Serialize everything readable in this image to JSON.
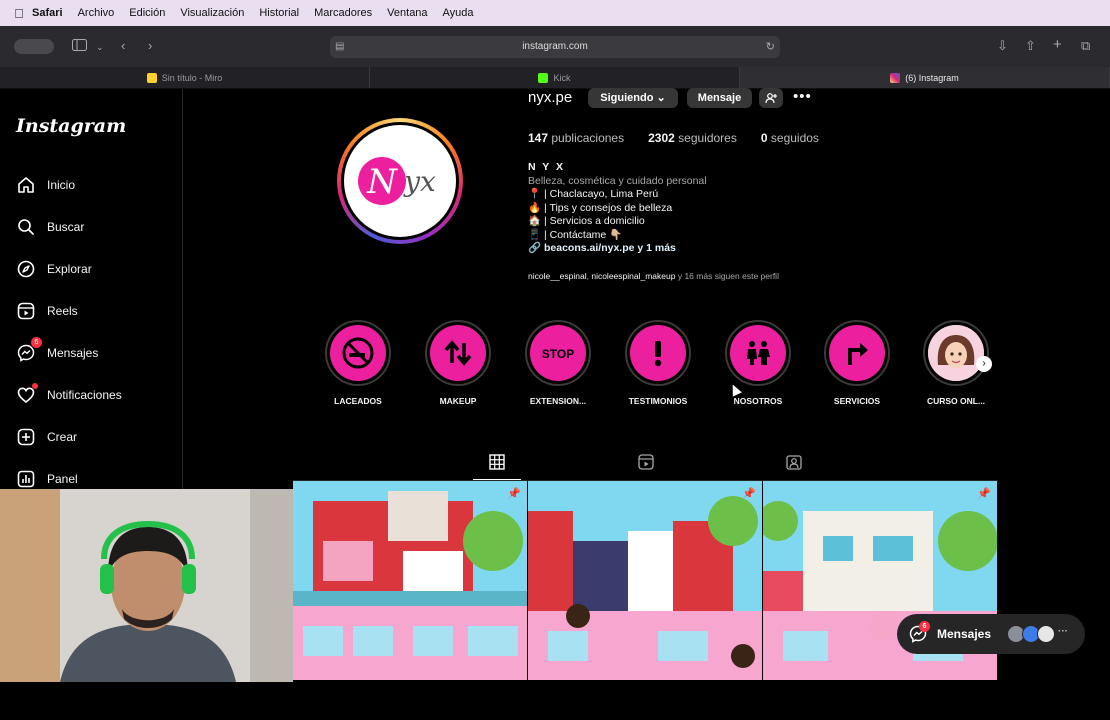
{
  "menubar": {
    "apple": "",
    "items": [
      "Safari",
      "Archivo",
      "Edición",
      "Visualización",
      "Historial",
      "Marcadores",
      "Ventana",
      "Ayuda"
    ]
  },
  "browser": {
    "url": "instagram.com",
    "tabs": [
      {
        "title": "Sin título - Miro",
        "favicon_color": "#ffd02f",
        "active": false
      },
      {
        "title": "Kick",
        "favicon_color": "#53fc18",
        "active": false
      },
      {
        "title": "(6) Instagram",
        "favicon_color": "#e1306c",
        "active": true
      }
    ]
  },
  "sidebar": {
    "logo": "Instagram",
    "items": [
      {
        "label": "Inicio",
        "icon": "home-icon"
      },
      {
        "label": "Buscar",
        "icon": "search-icon"
      },
      {
        "label": "Explorar",
        "icon": "compass-icon"
      },
      {
        "label": "Reels",
        "icon": "reels-icon"
      },
      {
        "label": "Mensajes",
        "icon": "messenger-icon",
        "badge": "6"
      },
      {
        "label": "Notificaciones",
        "icon": "heart-icon",
        "dot": true
      },
      {
        "label": "Crear",
        "icon": "plus-square-icon"
      },
      {
        "label": "Panel",
        "icon": "chart-icon"
      }
    ]
  },
  "profile": {
    "username": "nyx.pe",
    "following_btn": "Siguiendo",
    "message_btn": "Mensaje",
    "more": "•••",
    "avatar_text": "NYX",
    "stats": {
      "posts_count": "147",
      "posts_label": "publicaciones",
      "followers_count": "2302",
      "followers_label": "seguidores",
      "following_count": "0",
      "following_label": "seguidos"
    },
    "bio": {
      "name": "N Y X",
      "category": "Belleza, cosmética y cuidado personal",
      "lines": [
        "📍 | Chaclacayo, Lima Perú",
        "🔥 | Tips y consejos de belleza",
        "🏠 | Servicios a domicilio",
        "📱 | Contáctame 👇🏼"
      ],
      "link": "beacons.ai/nyx.pe y 1 más"
    },
    "followed_by": {
      "user1": "nicole__espinal",
      "user2": "nicoleespinal_makeup",
      "rest": "y 16 más siguen este perfil"
    }
  },
  "highlights": [
    {
      "label": "LACEADOS",
      "icon": "no-smoking-icon"
    },
    {
      "label": "MAKEUP",
      "icon": "up-down-arrows-icon"
    },
    {
      "label": "EXTENSION...",
      "icon": "stop-sign-icon"
    },
    {
      "label": "TESTIMONIOS",
      "icon": "exclamation-icon"
    },
    {
      "label": "NOSOTROS",
      "icon": "people-icon"
    },
    {
      "label": "SERVICIOS",
      "icon": "turn-right-icon"
    },
    {
      "label": "CURSO ONL...",
      "icon": "avatar-girl"
    }
  ],
  "messages_pill": {
    "label": "Mensajes",
    "badge": "6"
  },
  "colors": {
    "highlight_pink": "#ec1f9e",
    "badge_red": "#ff3040"
  }
}
